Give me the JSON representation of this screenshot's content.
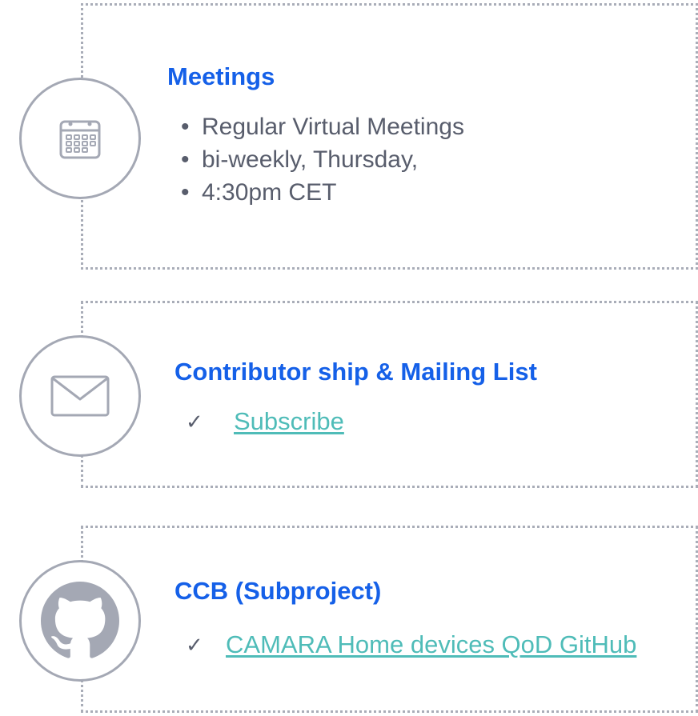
{
  "meetings": {
    "title": "Meetings",
    "icon": "calendar-icon",
    "bullets": [
      "Regular Virtual Meetings",
      "bi-weekly, Thursday,",
      "4:30pm CET"
    ]
  },
  "mailing": {
    "title": "Contributor ship & Mailing List",
    "icon": "envelope-icon",
    "check_mark": "✓",
    "link_label": "Subscribe"
  },
  "ccb": {
    "title": "CCB (Subproject)",
    "icon": "github-icon",
    "check_mark": "✓",
    "link_label": "CAMARA Home devices QoD GitHub"
  },
  "colors": {
    "title": "#1560e8",
    "body_text": "#585d6c",
    "link": "#4fbcb8",
    "icon_gray": "#a4a8b4",
    "border": "#a9adb8"
  }
}
